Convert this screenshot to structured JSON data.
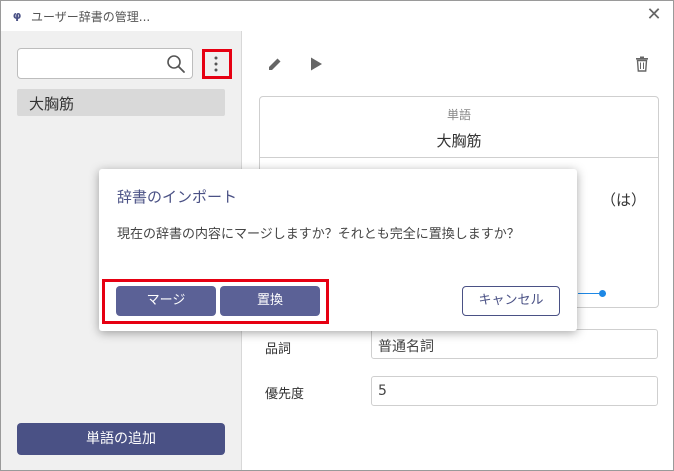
{
  "window": {
    "app_icon": "φ",
    "title": "ユーザー辞書の管理...",
    "close_glyph": "✕"
  },
  "sidebar": {
    "search": {
      "value": "",
      "placeholder": ""
    },
    "words": [
      {
        "label": "大胸筋"
      }
    ],
    "add_button_label": "単語の追加"
  },
  "main": {
    "card": {
      "surface_label": "単語",
      "surface_value": "大胸筋",
      "wa_text": "（は）"
    },
    "fields": [
      {
        "label": "品詞",
        "value": "普通名詞"
      },
      {
        "label": "優先度",
        "value": "5"
      }
    ]
  },
  "dialog": {
    "title": "辞書のインポート",
    "message": "現在の辞書の内容にマージしますか？それとも完全に置換しますか？",
    "merge_label": "マージ",
    "replace_label": "置換",
    "cancel_label": "キャンセル"
  },
  "colors": {
    "accent": "#4a5185",
    "highlight": "#e60012",
    "slider": "#1e88e5"
  }
}
